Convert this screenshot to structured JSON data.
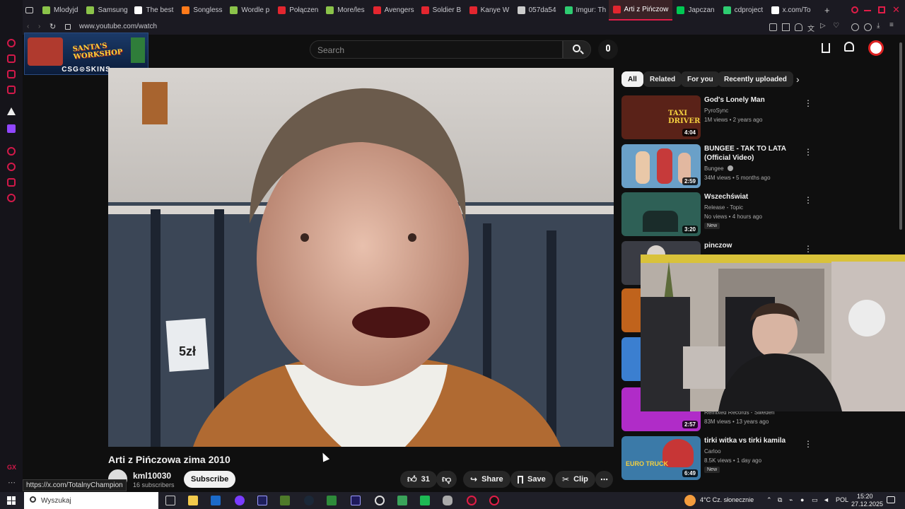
{
  "browser": {
    "tabs": [
      {
        "label": "Mlodyjd",
        "color": "#8bc34a"
      },
      {
        "label": "Samsung",
        "color": "#8bc34a"
      },
      {
        "label": "The best",
        "color": "#ffffff"
      },
      {
        "label": "Songless",
        "color": "#ff7a1a"
      },
      {
        "label": "Wordle p",
        "color": "#8bc34a"
      },
      {
        "label": "Połączen",
        "color": "#e3262f"
      },
      {
        "label": "More/les",
        "color": "#8bc34a"
      },
      {
        "label": "Avengers",
        "color": "#e3262f"
      },
      {
        "label": "Soldier B",
        "color": "#e3262f"
      },
      {
        "label": "Kanye W",
        "color": "#e3262f"
      },
      {
        "label": "057da54",
        "color": "#cccccc"
      },
      {
        "label": "Imgur: Th",
        "color": "#2ecc71"
      },
      {
        "label": "Arti z Pińczow",
        "color": "#e3262f",
        "active": true
      },
      {
        "label": "Japczan",
        "color": "#00c853"
      },
      {
        "label": "cdproject",
        "color": "#2ecc71"
      },
      {
        "label": "x.com/To",
        "color": "#ffffff"
      }
    ],
    "url": "www.youtube.com/watch",
    "status_url": "https://x.com/TotalnyChampion"
  },
  "header": {
    "search_placeholder": "Search"
  },
  "stream_overlay": {
    "title": "SANTA'S WORKSHOP",
    "sponsor": "CSG⊙SKINS"
  },
  "video": {
    "sign_text": "5zł",
    "title": "Arti z Pińczowa zima 2010",
    "channel": "kml10030",
    "subscribers": "16 subscribers",
    "subscribe_label": "Subscribe",
    "likes": "31",
    "share_label": "Share",
    "save_label": "Save",
    "clip_label": "Clip"
  },
  "filters": {
    "chips": [
      "All",
      "Related",
      "For you",
      "Recently uploaded"
    ]
  },
  "recommendations": [
    {
      "title": "God's Lonely Man",
      "channel": "PyroSync",
      "meta": "1M views • 2 years ago",
      "duration": "4:04",
      "thumb_text": "TAXI DRIVER",
      "thumb_color": "#5a2218"
    },
    {
      "title": "BUNGEE - TAK TO LATA (Official Video)",
      "channel": "Bungee",
      "meta": "34M views • 5 months ago",
      "duration": "2:59",
      "thumb_color": "#6aa0c8"
    },
    {
      "title": "Wszechświat",
      "channel": "Release - Topic",
      "meta": "No views • 4 hours ago",
      "duration": "3:20",
      "badge": "New",
      "thumb_color": "#2e6056"
    },
    {
      "title": "pinczow",
      "channel": "",
      "meta": "",
      "duration": "",
      "thumb_color": "#3a3c44"
    },
    {
      "title": "",
      "channel": "Remixed Records - Sweden",
      "meta": "83M views • 13 years ago",
      "duration": "2:57",
      "thumb_color": "#b02cc8"
    },
    {
      "title": "tirki witka vs tirki kamila",
      "channel": "Carloo",
      "meta": "8.5K views • 1 day ago",
      "duration": "6:49",
      "badge": "New",
      "thumb_text": "EURO TRUCK",
      "thumb_color": "#3b7aa8"
    }
  ],
  "taskbar": {
    "search_label": "Wyszukaj",
    "weather": "4°C  Cz. słonecznie",
    "language": "POL",
    "time": "15:20",
    "date": "27.12.2025"
  }
}
